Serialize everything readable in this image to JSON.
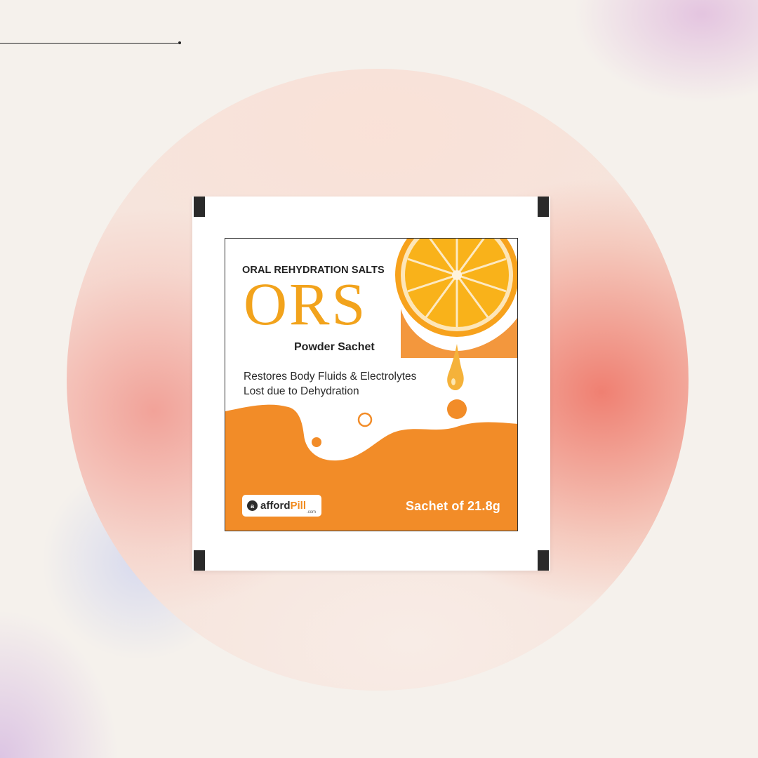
{
  "product": {
    "top_subtitle": "ORAL REHYDRATION SALTS",
    "brand_name": "ORS",
    "format": "Powder Sachet",
    "claim_lines": [
      "Restores Body Fluids & Electrolytes",
      "Lost due to Dehydration"
    ],
    "pack_size": "Sachet of 21.8g"
  },
  "logo": {
    "part1": "afford",
    "part2": "Pill",
    "suffix": ".com",
    "badge_glyph": "a"
  },
  "icons": {
    "fruit": "orange-slice-icon",
    "drop": "juice-drop-icon"
  },
  "colors": {
    "brand_orange": "#f2a31c",
    "wave_orange": "#f28c28",
    "background": "#f5f1ec"
  }
}
